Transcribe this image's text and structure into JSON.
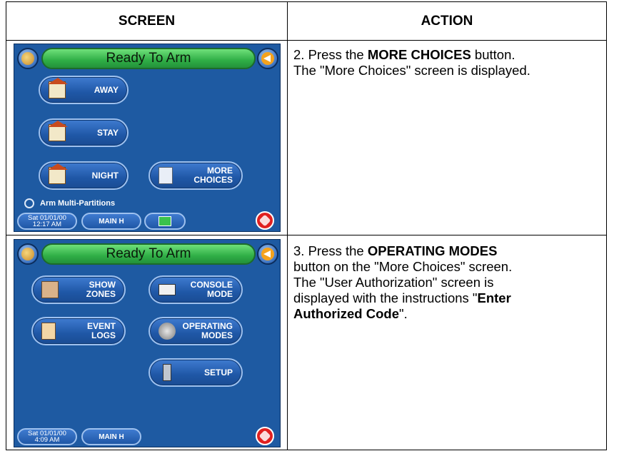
{
  "table": {
    "headers": {
      "screen": "SCREEN",
      "action": "ACTION"
    }
  },
  "rows": [
    {
      "step_prefix": "2.  Press the ",
      "step_bold": "MORE CHOICES",
      "step_suffix": " button.",
      "step_line2": "The \"More Choices\" screen is displayed.",
      "screen": {
        "title": "Ready To Arm",
        "buttons": {
          "away": "AWAY",
          "stay": "STAY",
          "night": "NIGHT",
          "more_choices_1": "MORE",
          "more_choices_2": "CHOICES"
        },
        "radio_label": "Arm Multi-Partitions",
        "date_line1": "Sat 01/01/00",
        "date_line2": "12:17 AM",
        "partition": "MAIN H"
      }
    },
    {
      "step_prefix": "3.  Press the ",
      "step_bold": "OPERATING MODES",
      "step_line2": "button on the \"More Choices\" screen.",
      "step_line3": "The \"User Authorization\" screen is",
      "step_line4_prefix": "displayed with the instructions \"",
      "step_line4_bold": "Enter",
      "step_line5_bold": "Authorized Code",
      "step_line5_suffix": "\".",
      "screen": {
        "title": "Ready To Arm",
        "buttons": {
          "show_zones_1": "SHOW",
          "show_zones_2": "ZONES",
          "console_mode_1": "CONSOLE",
          "console_mode_2": "MODE",
          "event_logs_1": "EVENT",
          "event_logs_2": "LOGS",
          "operating_modes_1": "OPERATING",
          "operating_modes_2": "MODES",
          "setup": "SETUP"
        },
        "date_line1": "Sat 01/01/00",
        "date_line2": "4:09 AM",
        "partition": "MAIN H"
      }
    }
  ],
  "colors": {
    "screen_bg": "#1e5aa2",
    "title_green": "#2fae46",
    "alarm_red": "#e02020"
  }
}
